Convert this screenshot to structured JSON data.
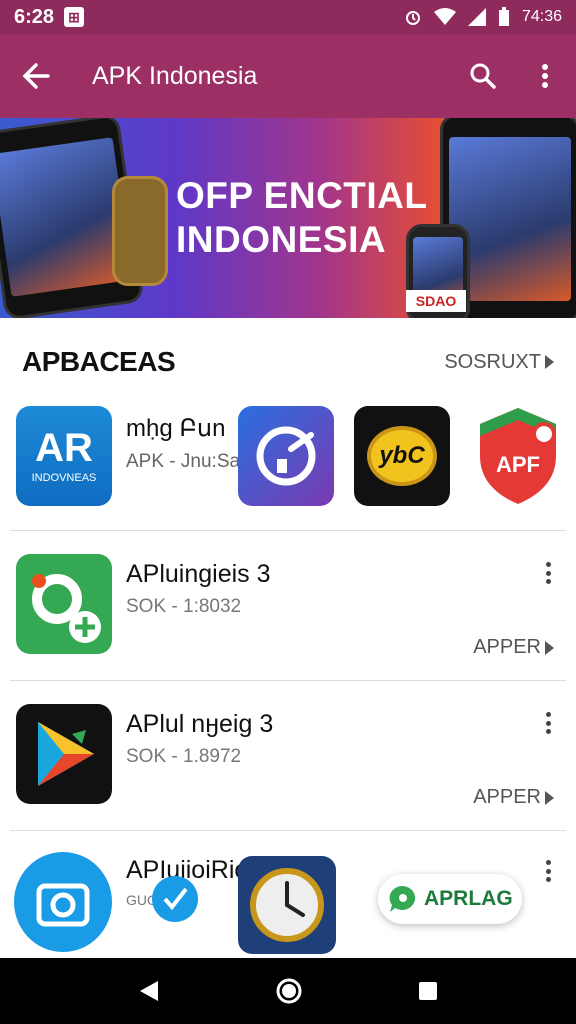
{
  "status_bar": {
    "time": "6:28",
    "notif_glyph": "⊞",
    "right_text": "74:36"
  },
  "app_bar": {
    "title": "APK Indonesia"
  },
  "banner": {
    "line1": "OFP ENCTIAL",
    "line2": "INDONESIA",
    "phone_label": "SDAO"
  },
  "section": {
    "title": "APBACEAS",
    "see_all": "SOSRUXT"
  },
  "featured": {
    "name": "mḥg Բսn",
    "meta": "APK - Jnu:Sa",
    "icon1_big": "AR",
    "icon1_small": "INDOVNEAS",
    "icon3_text": "ybC",
    "icon4_text": "APF"
  },
  "rows": [
    {
      "name": "APluingieis 3",
      "meta": "SOK - 1:8032",
      "action": "APPER"
    },
    {
      "name": "APlul nӈeig 3",
      "meta": "SOK - 1.8972",
      "action": "APPER"
    },
    {
      "name": "APIujioiRio",
      "meta": "GUO"
    }
  ],
  "floating": {
    "pill_label": "APRLAG"
  },
  "colors": {
    "status_bg": "#8e2a5c",
    "appbar_bg": "#9c2f63",
    "accent_green": "#34a853"
  }
}
